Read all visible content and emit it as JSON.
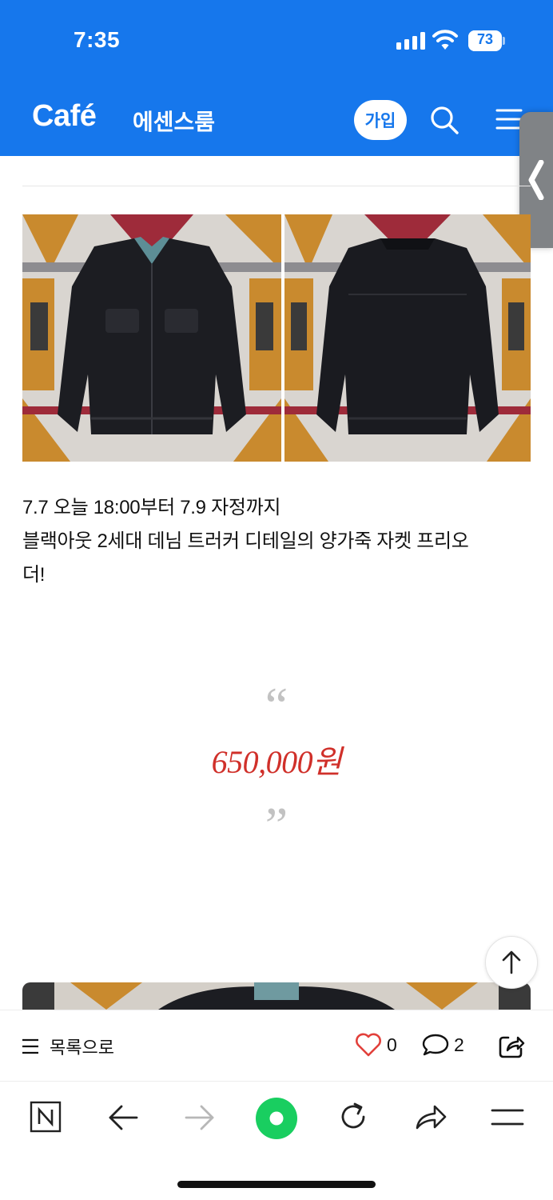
{
  "status_bar": {
    "time": "7:35",
    "battery_level": "73"
  },
  "cafe_header": {
    "brand": "Café",
    "cafe_name": "에센스룸",
    "join_label": "가입",
    "bg_color": "#1677ec"
  },
  "article": {
    "description_lines": [
      "7.7 오늘 18:00부터 7.9 자정까지",
      "블랙아웃 2세대 데님 트러커 디테일의 양가죽 자켓 프리오",
      "더!"
    ],
    "quote_open": "“",
    "price": "650,000원",
    "quote_close": "”",
    "price_color": "#d0302a",
    "photos": [
      {
        "icon": "jacket-front-photo"
      },
      {
        "icon": "jacket-back-photo"
      }
    ]
  },
  "article_bar": {
    "list_label": "목록으로",
    "like_count": "0",
    "comment_count": "2"
  },
  "browser_toolbar": {
    "items": [
      "naver-n-icon",
      "back-arrow-icon",
      "forward-arrow-icon",
      "green-dot-icon",
      "refresh-icon",
      "share-arrow-icon",
      "menu-icon"
    ]
  }
}
